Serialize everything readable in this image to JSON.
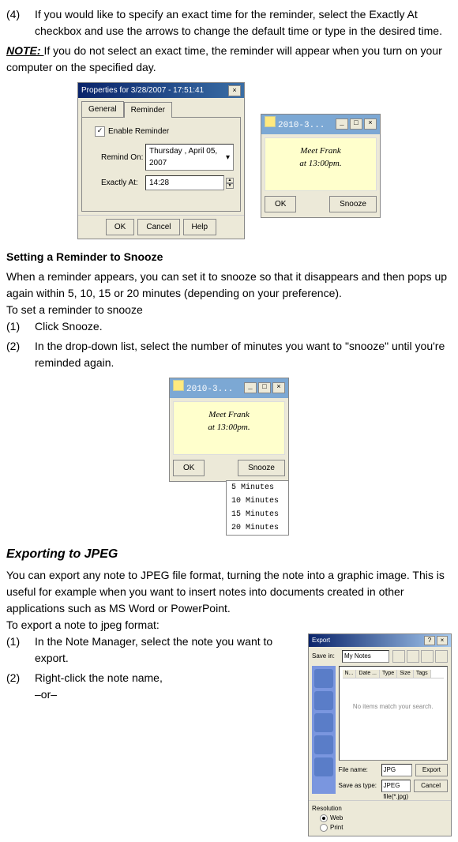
{
  "step4": {
    "num": "(4)",
    "text": "If you would like to specify an exact time for the reminder, select the Exactly At checkbox and use the arrows to change the default time or type in the desired time."
  },
  "note": {
    "label": "NOTE: ",
    "text": "If you do not select an exact time, the reminder will appear when you turn on your computer on the specified day."
  },
  "dialog1": {
    "title": "Properties for 3/28/2007 - 17:51:41",
    "tabs": {
      "general": "General",
      "reminder": "Reminder"
    },
    "enable": "Enable Reminder",
    "remind_on_label": "Remind On:",
    "remind_on_value": "Thursday ,   April     05, 2007",
    "exactly_label": "Exactly At:",
    "exactly_value": "14:28",
    "ok": "OK",
    "cancel": "Cancel",
    "help": "Help"
  },
  "sticky": {
    "title": "2010-3...",
    "note_line1": "Meet  Frank",
    "note_line2": "at 13:00pm.",
    "ok": "OK",
    "snooze": "Snooze"
  },
  "section_snooze": {
    "heading": "Setting a Reminder to Snooze",
    "p": "When a reminder appears, you can set it to snooze so that it disappears and then pops up again within 5, 10, 15 or 20 minutes (depending on your preference).",
    "p2": "To set a reminder to snooze",
    "s1n": "(1)",
    "s1t": "Click Snooze.",
    "s2n": "(2)",
    "s2t": "In the drop-down list, select the number of minutes you want to \"snooze\" until you're reminded again."
  },
  "snooze_menu": {
    "i1": "5 Minutes",
    "i2": "10 Minutes",
    "i3": "15 Minutes",
    "i4": "20 Minutes"
  },
  "section_export": {
    "heading": "Exporting to JPEG",
    "p": "You can export any note to JPEG file format, turning the note into a graphic image. This is useful for example when you want to insert notes into documents created in other applications such as MS Word or PowerPoint.",
    "p2": "To export a note to jpeg format:",
    "s1n": "(1)",
    "s1t": "In the Note Manager, select the note you want to export.",
    "s2n": "(2)",
    "s2t": "Right-click the note name,",
    "s2or": "–or–"
  },
  "exportdlg": {
    "title": "Export",
    "savein_label": "Save in:",
    "savein_value": "My Notes",
    "empty": "No items match your search.",
    "cols": {
      "c1": "N...",
      "c2": "Date ...",
      "c3": "Type",
      "c4": "Size",
      "c5": "Tags"
    },
    "filename_label": "File name:",
    "filename_value": "JPG",
    "saveas_label": "Save as type:",
    "saveas_value": "JPEG file(*.jpg)",
    "export_btn": "Export",
    "cancel_btn": "Cancel",
    "resolution": "Resolution",
    "web": "Web",
    "print": "Print"
  }
}
